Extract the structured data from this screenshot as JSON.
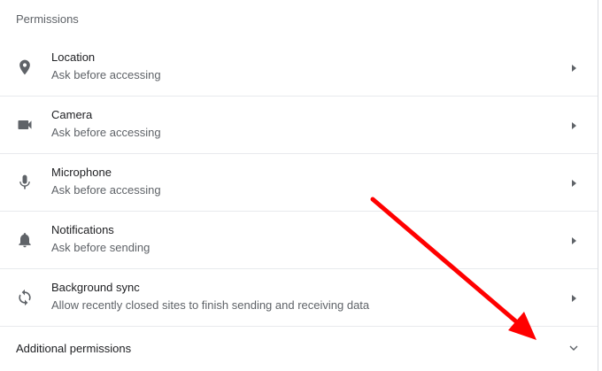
{
  "section": {
    "title": "Permissions"
  },
  "permissions": [
    {
      "icon": "location-pin-icon",
      "title": "Location",
      "subtitle": "Ask before accessing"
    },
    {
      "icon": "camera-icon",
      "title": "Camera",
      "subtitle": "Ask before accessing"
    },
    {
      "icon": "microphone-icon",
      "title": "Microphone",
      "subtitle": "Ask before accessing"
    },
    {
      "icon": "bell-icon",
      "title": "Notifications",
      "subtitle": "Ask before sending"
    },
    {
      "icon": "sync-icon",
      "title": "Background sync",
      "subtitle": "Allow recently closed sites to finish sending and receiving data"
    }
  ],
  "additional": {
    "label": "Additional permissions",
    "icon": "chevron-down-icon"
  },
  "annotation": {
    "color": "#ff0000",
    "icon": "red-arrow-annotation"
  },
  "colors": {
    "text_primary": "#202124",
    "text_secondary": "#5f6368",
    "divider": "#e8eaed"
  }
}
